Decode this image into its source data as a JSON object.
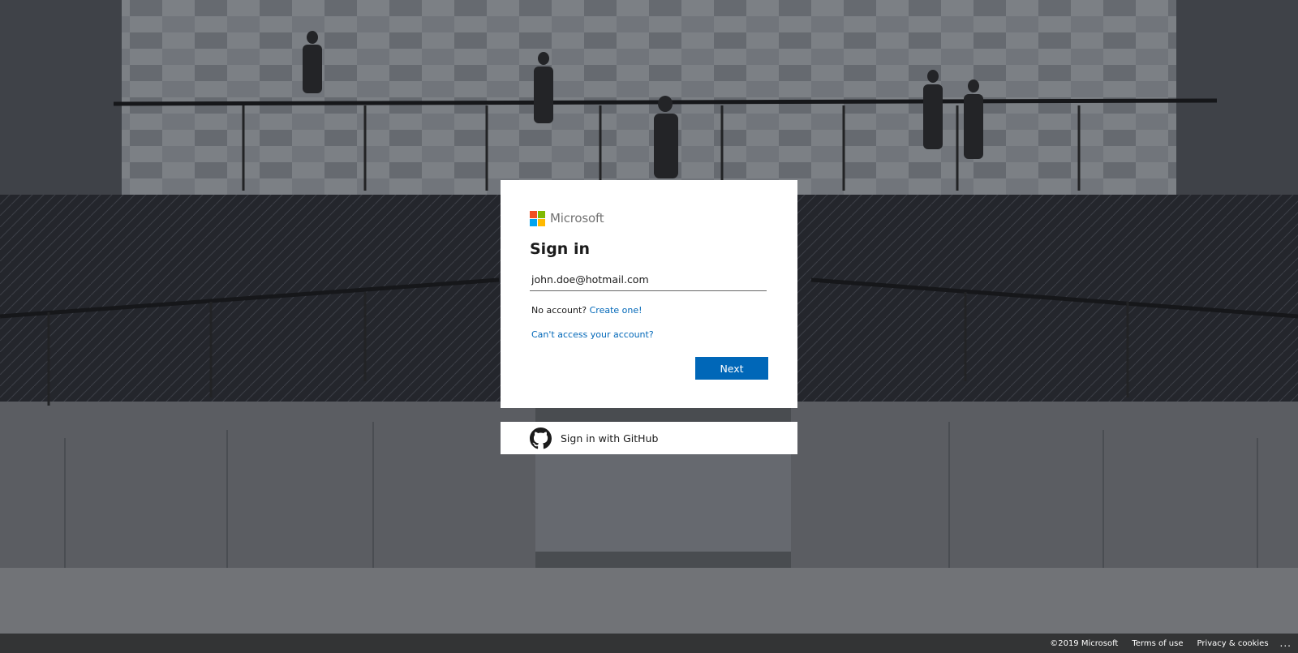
{
  "brand": {
    "name": "Microsoft",
    "logo_colors": [
      "#f25022",
      "#7fba00",
      "#00a4ef",
      "#ffb900"
    ]
  },
  "signin": {
    "title": "Sign in",
    "email_value": "john.doe@hotmail.com",
    "no_account_text": "No account?",
    "create_link": "Create one!",
    "cant_access_link": "Can't access your account?",
    "next_label": "Next"
  },
  "github": {
    "label": "Sign in with GitHub",
    "icon": "github-icon"
  },
  "footer": {
    "copyright": "©2019 Microsoft",
    "terms": "Terms of use",
    "privacy": "Privacy & cookies",
    "more": "..."
  },
  "colors": {
    "accent": "#0067b8",
    "card_bg": "#ffffff",
    "text": "#1b1b1b"
  }
}
